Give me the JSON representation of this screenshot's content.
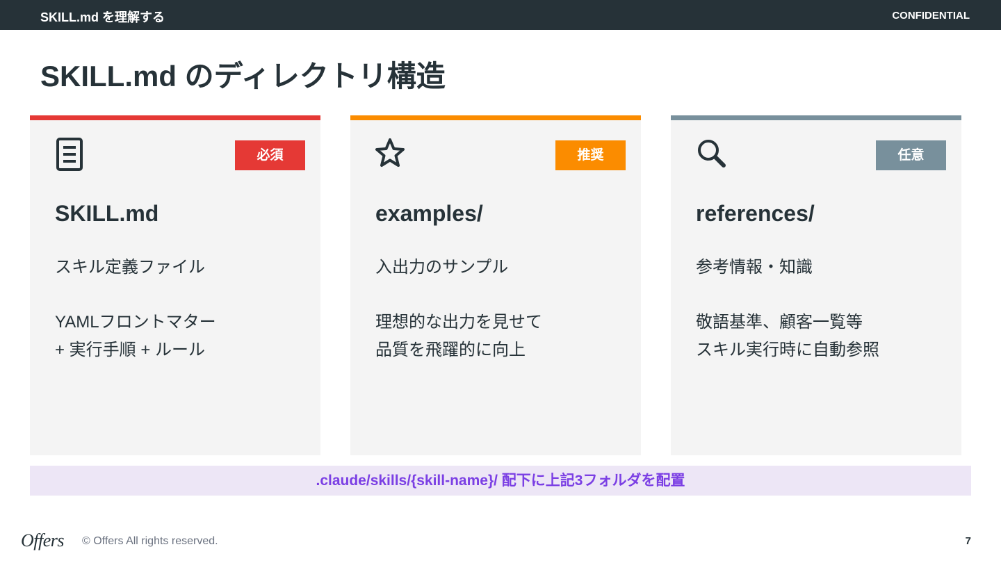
{
  "header": {
    "section": "SKILL.md を理解する",
    "label": "CONFIDENTIAL"
  },
  "title": "SKILL.md のディレクトリ構造",
  "cards": [
    {
      "icon": "document-icon",
      "badge": "必須",
      "badge_color": "#e53935",
      "accent": "#e53935",
      "name": "SKILL.md",
      "desc": "スキル定義ファイル",
      "detail": [
        "YAMLフロントマター",
        "+ 実行手順 + ルール"
      ]
    },
    {
      "icon": "star-icon",
      "badge": "推奨",
      "badge_color": "#fb8c00",
      "accent": "#fb8c00",
      "name": "examples/",
      "desc": "入出力のサンプル",
      "detail": [
        "理想的な出力を見せて",
        "品質を飛躍的に向上"
      ]
    },
    {
      "icon": "search-icon",
      "badge": "任意",
      "badge_color": "#78909c",
      "accent": "#78909c",
      "name": "references/",
      "desc": "参考情報・知識",
      "detail": [
        "敬語基準、顧客一覧等",
        "スキル実行時に自動参照"
      ]
    }
  ],
  "path_note": ".claude/skills/{skill-name}/  配下に上記3フォルダを配置",
  "footer": {
    "logo": "Offers",
    "copyright": "© Offers All rights reserved.",
    "page": "7"
  }
}
